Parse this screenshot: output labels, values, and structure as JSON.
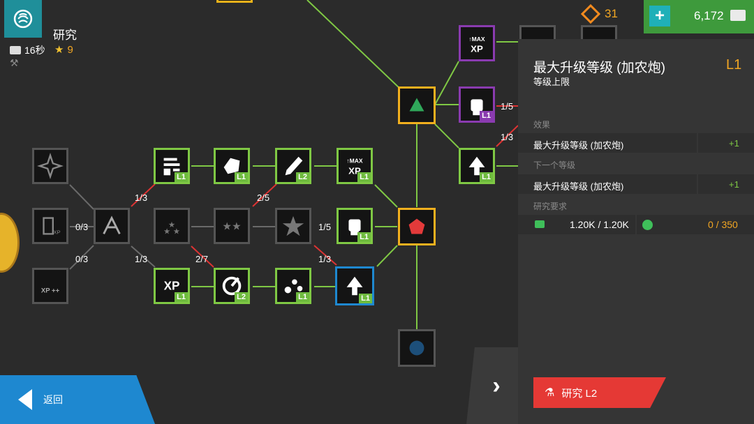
{
  "header": {
    "title": "研究",
    "timer": "16秒",
    "stars": "9",
    "currency_orange": "31",
    "currency_cash": "6,172",
    "accent_green": "#6fbb3f",
    "accent_blue": "#1e88d0"
  },
  "tree": {
    "node_levels": {
      "xp_l1": "L1",
      "ring_l2": "L2",
      "burst_l1": "L1",
      "aim_l1": "L1",
      "emp_l1": "L1",
      "stars_l1": "L1",
      "fist_l1": "L1",
      "doc_l1": "L1",
      "dino_l1": "L1",
      "pen_l2": "L2",
      "maxxp_l1": "L1",
      "fist_purple_l1": "L1",
      "arrow_right_l1": "L1"
    },
    "counters": {
      "c1": "1/3",
      "c2": "2/5",
      "c3": "1/5",
      "c4": "0/3",
      "c5": "0/3",
      "c6": "1/3",
      "c7": "2/7",
      "c8": "1/3",
      "c9": "1/5",
      "c10": "1/3"
    }
  },
  "detail": {
    "title": "最大升级等级 (加农炮)",
    "level": "L1",
    "subtitle": "等级上限",
    "effect_heading": "效果",
    "effect_name": "最大升级等级 (加农炮)",
    "effect_value": "+1",
    "next_heading": "下一个等级",
    "next_name": "最大升级等级 (加农炮)",
    "next_value": "+1",
    "req_heading": "研究要求",
    "req_cash": "1.20K / 1.20K",
    "req_research": "0 / 350",
    "research_button": "研究 L2"
  },
  "nav": {
    "back": "返回"
  }
}
